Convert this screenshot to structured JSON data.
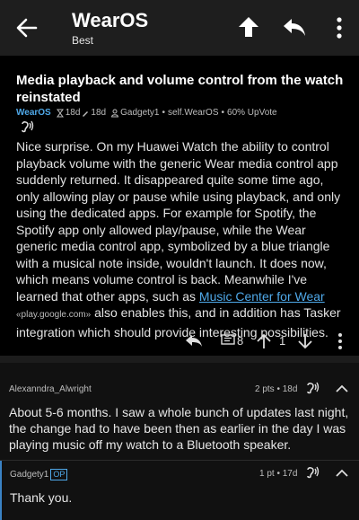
{
  "appbar": {
    "title": "WearOS",
    "subtitle": "Best"
  },
  "post": {
    "title": "Media playback and volume control from the watch reinstated",
    "subreddit": "WearOS",
    "age": "18d",
    "edited": "18d",
    "author": "Gadgety1",
    "flair": "self.WearOS",
    "upvote": "60% UpVote",
    "body_1": "Nice surprise. On my Huawei Watch the ability to control playback volume with the generic Wear media control app suddenly returned. It disappeared quite some time ago, only allowing play or pause while using playback, and only using the dedicated apps. For example for Spotify, the Spotify app only allowed play/pause, while the Wear generic media control app, symbolized by a blue triangle with a musical note inside, wouldn't launch. It does now, which means volume control is back. Meanwhile I've learned that other apps, such as ",
    "link_text": "Music Center for Wear",
    "link_domain": "«play.google.com»",
    "body_2": " also enables this, and in addition has Tasker integration which should provide interesting possibilities.",
    "comment_count": "8",
    "score": "1"
  },
  "comments": [
    {
      "author": "Alexanndra_Alwright",
      "info": "2 pts • 18d",
      "text": "About 5-6 months. I saw a whole bunch of updates last night, the change had to have been then as earlier in the day I was playing music off my watch to a Bluetooth speaker."
    },
    {
      "author": "Gadgety1",
      "badge": "OP",
      "info": "1 pt • 17d",
      "text": "Thank you."
    }
  ],
  "colors": {
    "accent": "#4fa8e8",
    "appbar": "#1e1e1e",
    "background": "#000000",
    "comment_bg": "#111111"
  },
  "icons": [
    "back-arrow-icon",
    "upvote-arrow-icon",
    "reply-icon",
    "more-vert-icon",
    "hourglass-icon",
    "edit-pencil-icon",
    "user-icon",
    "listen-icon",
    "comments-icon",
    "downvote-arrow-icon",
    "collapse-chevron-icon"
  ]
}
